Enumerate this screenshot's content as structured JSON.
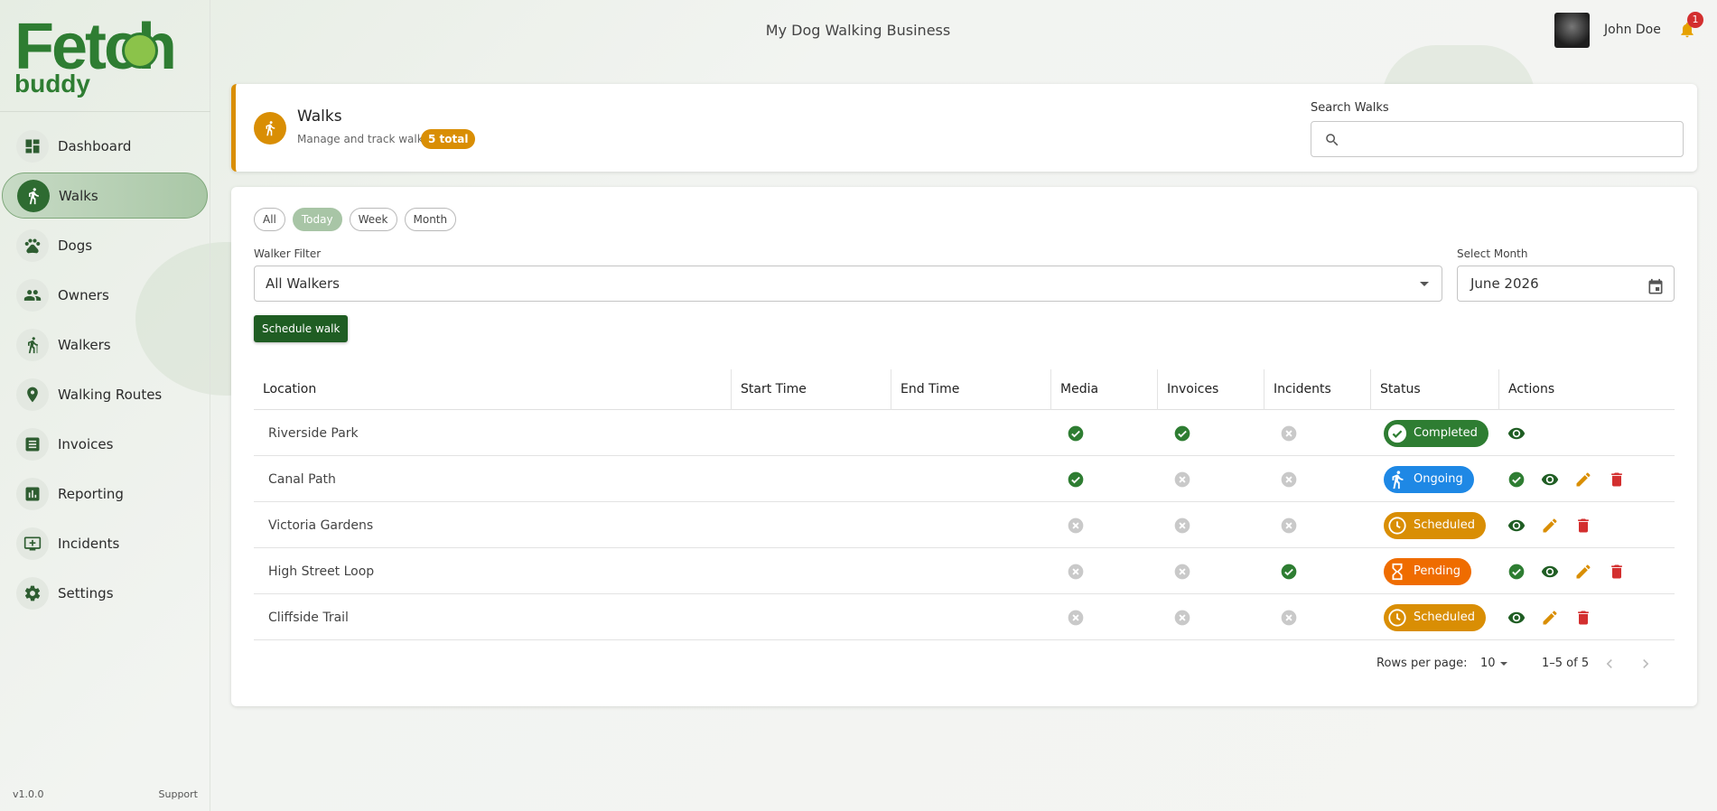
{
  "app": {
    "logo_top": "Fetch",
    "logo_bottom": "buddy",
    "business_name": "My Dog Walking Business",
    "version": "v1.0.0",
    "support_label": "Support"
  },
  "user": {
    "name": "John Doe",
    "notification_count": "1"
  },
  "sidebar": {
    "items": [
      {
        "label": "Dashboard",
        "icon": "dashboard-icon"
      },
      {
        "label": "Walks",
        "icon": "walk-icon",
        "active": true
      },
      {
        "label": "Dogs",
        "icon": "paw-icon"
      },
      {
        "label": "Owners",
        "icon": "people-icon"
      },
      {
        "label": "Walkers",
        "icon": "hiker-icon"
      },
      {
        "label": "Walking Routes",
        "icon": "location-pin-icon"
      },
      {
        "label": "Invoices",
        "icon": "list-icon"
      },
      {
        "label": "Reporting",
        "icon": "chart-icon"
      },
      {
        "label": "Incidents",
        "icon": "incident-icon"
      },
      {
        "label": "Settings",
        "icon": "gear-icon"
      }
    ]
  },
  "header": {
    "title": "Walks",
    "subtitle": "Manage and track walks",
    "total_badge": "5 total",
    "search_label": "Search Walks",
    "search_placeholder": "",
    "search_value": ""
  },
  "filters": {
    "chips": [
      "All",
      "Today",
      "Week",
      "Month"
    ],
    "active_chip": "Today",
    "walker_label": "Walker Filter",
    "walker_value": "All Walkers",
    "month_label": "Select Month",
    "month_value": "June 2026",
    "schedule_button": "Schedule walk"
  },
  "table": {
    "columns": [
      "Location",
      "Start Time",
      "End Time",
      "Media",
      "Invoices",
      "Incidents",
      "Status",
      "Actions"
    ],
    "rows": [
      {
        "location": "Riverside Park",
        "start": "",
        "end": "",
        "media": true,
        "invoices": true,
        "incidents": false,
        "status": "Completed",
        "actions": [
          "view"
        ]
      },
      {
        "location": "Canal Path",
        "start": "",
        "end": "",
        "media": true,
        "invoices": false,
        "incidents": false,
        "status": "Ongoing",
        "actions": [
          "complete",
          "view",
          "edit",
          "delete"
        ]
      },
      {
        "location": "Victoria Gardens",
        "start": "",
        "end": "",
        "media": false,
        "invoices": false,
        "incidents": false,
        "status": "Scheduled",
        "actions": [
          "view",
          "edit",
          "delete"
        ]
      },
      {
        "location": "High Street Loop",
        "start": "",
        "end": "",
        "media": false,
        "invoices": false,
        "incidents": true,
        "status": "Pending",
        "actions": [
          "complete",
          "view",
          "edit",
          "delete"
        ]
      },
      {
        "location": "Cliffside Trail",
        "start": "",
        "end": "",
        "media": false,
        "invoices": false,
        "incidents": false,
        "status": "Scheduled",
        "actions": [
          "view",
          "edit",
          "delete"
        ]
      }
    ]
  },
  "pagination": {
    "rows_per_page_label": "Rows per page:",
    "rows_per_page": "10",
    "range": "1–5 of 5"
  },
  "colors": {
    "brand_green": "#2e7d32",
    "accent_orange": "#d98e04",
    "completed": "#2e7d32",
    "ongoing": "#1e88e5",
    "scheduled": "#d98e04",
    "pending": "#ef6c00",
    "delete": "#d32f2f"
  }
}
